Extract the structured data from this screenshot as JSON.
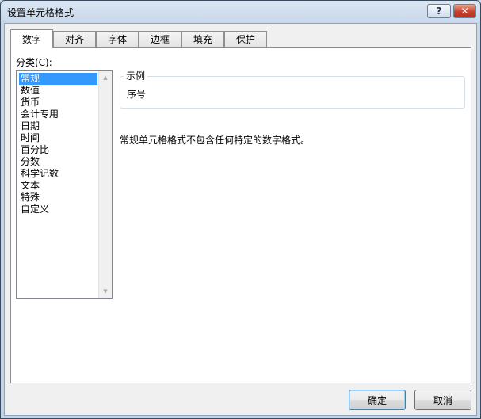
{
  "window": {
    "title": "设置单元格格式",
    "help_label": "?",
    "close_label": "✕"
  },
  "tabs": [
    {
      "label": "数字",
      "active": true
    },
    {
      "label": "对齐",
      "active": false
    },
    {
      "label": "字体",
      "active": false
    },
    {
      "label": "边框",
      "active": false
    },
    {
      "label": "填充",
      "active": false
    },
    {
      "label": "保护",
      "active": false
    }
  ],
  "category": {
    "label": "分类(C):",
    "selected": "常规",
    "items": [
      "常规",
      "数值",
      "货币",
      "会计专用",
      "日期",
      "时间",
      "百分比",
      "分数",
      "科学记数",
      "文本",
      "特殊",
      "自定义"
    ]
  },
  "sample": {
    "legend": "示例",
    "value": "序号"
  },
  "description": "常规单元格格式不包含任何特定的数字格式。",
  "buttons": {
    "ok": "确定",
    "cancel": "取消"
  },
  "colors": {
    "selection": "#3399ff",
    "close_button": "#c8402a"
  }
}
